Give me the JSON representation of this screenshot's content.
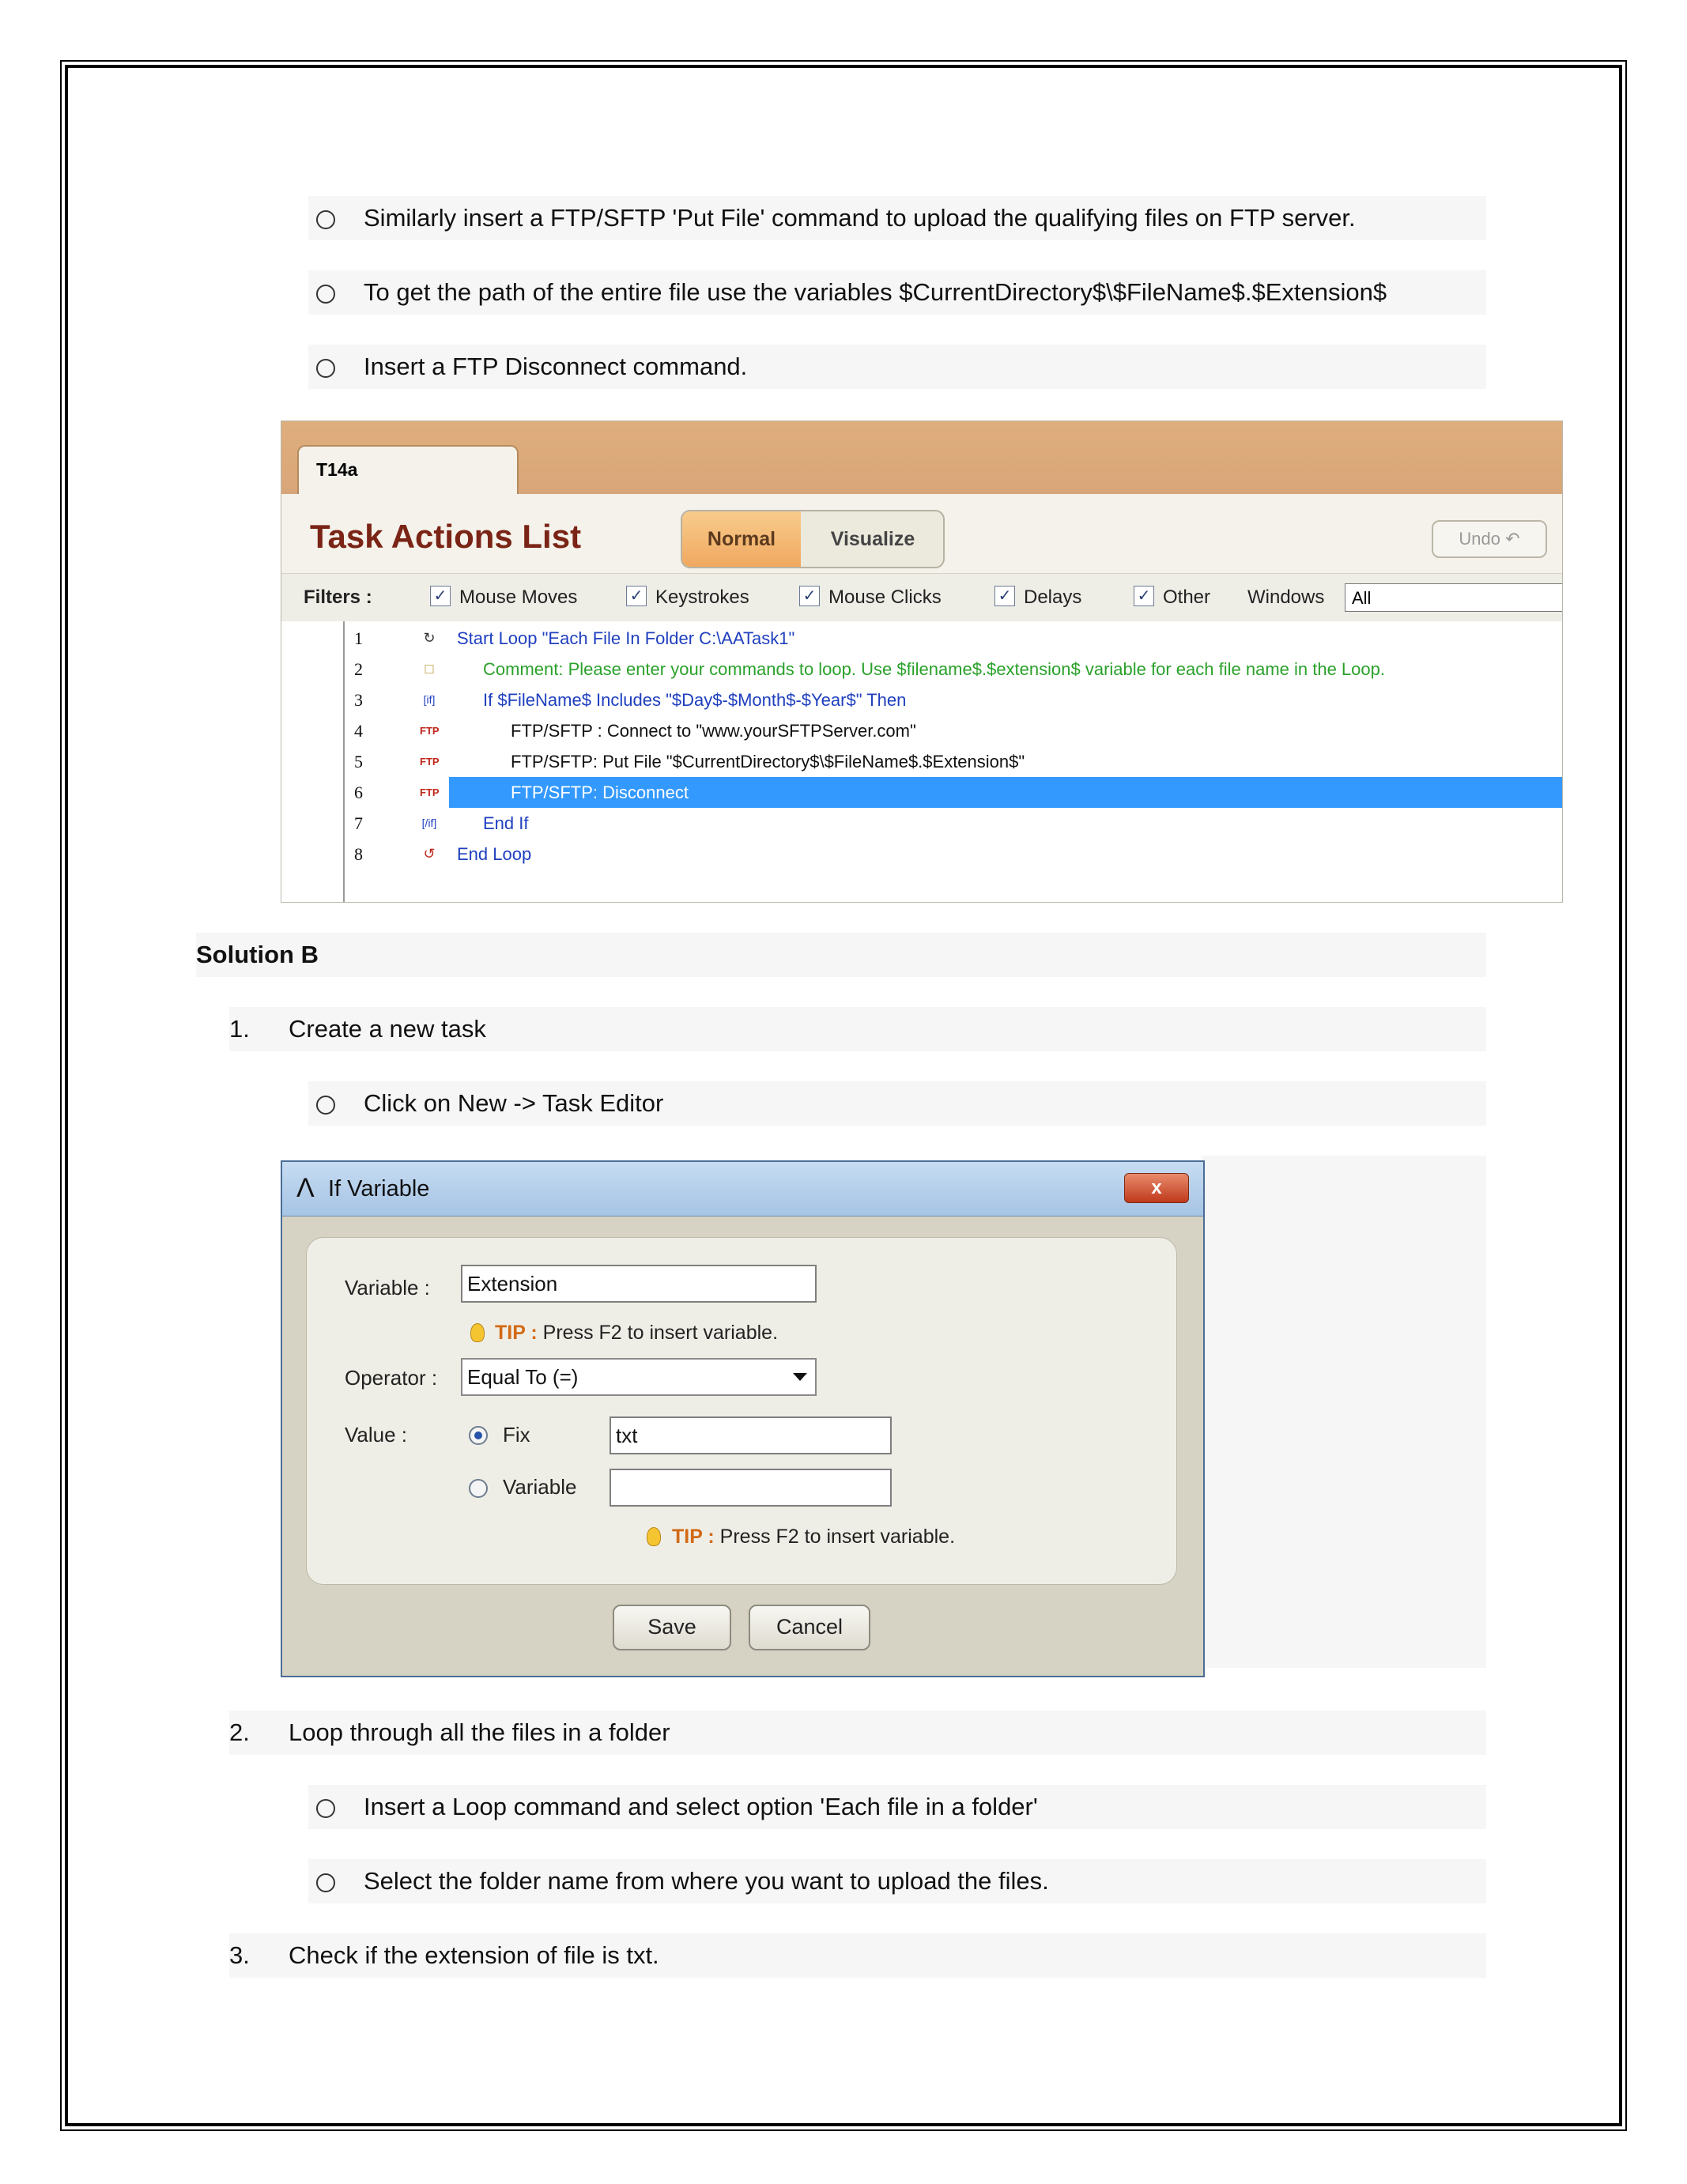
{
  "top_bullets": [
    "Similarly insert a FTP/SFTP 'Put File' command to upload the qualifying files on FTP server.",
    "To get the path of the entire file use the variables $CurrentDirectory$\\$FileName$.$Extension$",
    "Insert a FTP Disconnect command."
  ],
  "task_actions": {
    "tab": "T14a",
    "title": "Task Actions List",
    "mode_normal": "Normal",
    "mode_visualize": "Visualize",
    "undo": "Undo",
    "filters_label": "Filters :",
    "filters": [
      {
        "label": "Mouse Moves",
        "checked": true
      },
      {
        "label": "Keystrokes",
        "checked": true
      },
      {
        "label": "Mouse Clicks",
        "checked": true
      },
      {
        "label": "Delays",
        "checked": true
      },
      {
        "label": "Other",
        "checked": true
      }
    ],
    "windows_label": "Windows",
    "windows_value": "All",
    "rows": [
      {
        "num": "1",
        "text": "Start Loop \"Each File In Folder C:\\AATask1\"",
        "color": "#1f3fbf",
        "icon": "loop-start-icon"
      },
      {
        "num": "2",
        "text": "Comment: Please enter your commands to loop. Use $filename$.$extension$ variable for each file name in the Loop.",
        "color": "#2aa12a",
        "icon": "comment-icon"
      },
      {
        "num": "3",
        "text": "If $FileName$ Includes \"$Day$-$Month$-$Year$\" Then",
        "color": "#1f3fbf",
        "icon": "if-icon"
      },
      {
        "num": "4",
        "text": "FTP/SFTP : Connect to \"www.yourSFTPServer.com\"",
        "color": "#111111",
        "icon": "ftp-icon"
      },
      {
        "num": "5",
        "text": "FTP/SFTP: Put File \"$CurrentDirectory$\\$FileName$.$Extension$\"",
        "color": "#111111",
        "icon": "ftp-icon"
      },
      {
        "num": "6",
        "text": "FTP/SFTP: Disconnect",
        "color": "#ffffff",
        "icon": "ftp-icon",
        "selected": true
      },
      {
        "num": "7",
        "text": "End If",
        "color": "#1f3fbf",
        "icon": "end-if-icon"
      },
      {
        "num": "8",
        "text": "End Loop",
        "color": "#1f3fbf",
        "icon": "loop-end-icon"
      }
    ]
  },
  "solution_heading": "Solution B",
  "steps": [
    {
      "num": "1.",
      "text": "Create a new task"
    },
    {
      "num": "2.",
      "text": "Loop through all the files in a folder"
    },
    {
      "num": "3.",
      "text": "Check if the extension of file is txt."
    }
  ],
  "step1_bullets": [
    "Click on New -> Task Editor"
  ],
  "step2_bullets": [
    "Insert a Loop command and select option 'Each file in a folder'",
    "Select the folder name from where you want to upload the files."
  ],
  "dialog": {
    "title": "If Variable",
    "close": "x",
    "variable_label": "Variable :",
    "variable_value": "Extension",
    "tip_label": "TIP :",
    "tip_text": "Press F2 to insert variable.",
    "operator_label": "Operator :",
    "operator_value": "Equal To (=)",
    "value_label": "Value :",
    "fix_label": "Fix",
    "fix_value": "txt",
    "variable_option_label": "Variable",
    "variable_option_value": "",
    "save": "Save",
    "cancel": "Cancel"
  }
}
